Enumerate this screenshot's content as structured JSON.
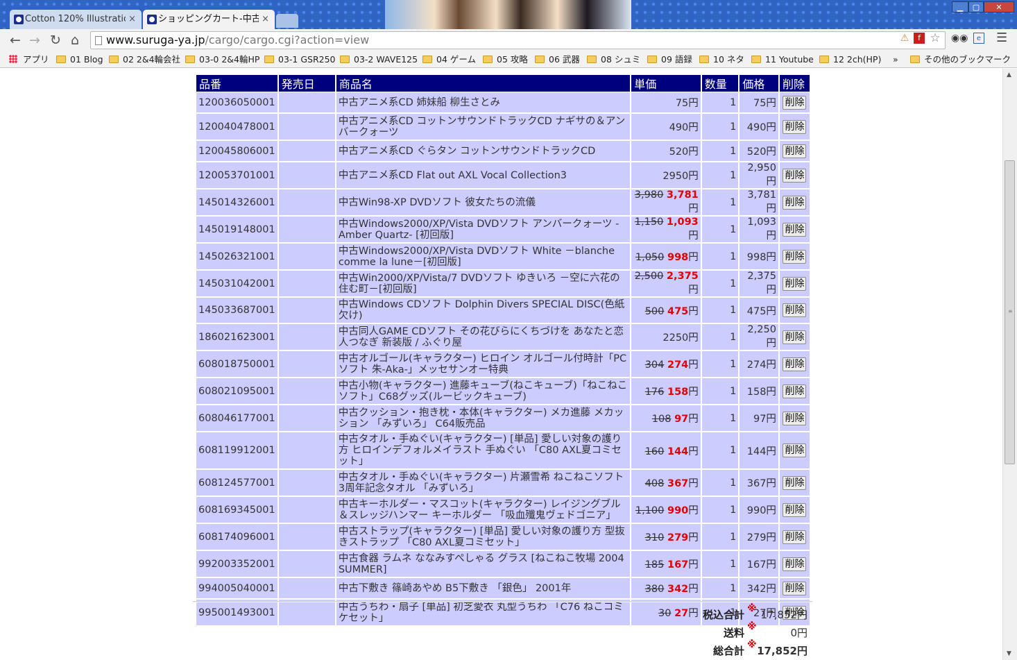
{
  "window": {
    "tabs": [
      {
        "label": "Cotton 120% Illustratio"
      },
      {
        "label": "ショッピングカート-中古"
      }
    ],
    "close_glyph": "×",
    "controls": {
      "minimize": "▁",
      "maximize": "▢",
      "close": "✕"
    }
  },
  "toolbar": {
    "url_host": "www.suruga-ya.jp",
    "url_path": "/cargo/cargo.cgi?action=view"
  },
  "bookmarks": {
    "apps_label": "アプリ",
    "items": [
      {
        "label": "01 Blog"
      },
      {
        "label": "02 2&4輪会社"
      },
      {
        "label": "03-0 2&4輪HP"
      },
      {
        "label": "03-1 GSR250"
      },
      {
        "label": "03-2 WAVE125"
      },
      {
        "label": "04 ゲーム"
      },
      {
        "label": "05 攻略"
      },
      {
        "label": "06 武器"
      },
      {
        "label": "08 シュミ"
      },
      {
        "label": "09 語録"
      },
      {
        "label": "10 ネタ"
      },
      {
        "label": "11 Youtube"
      },
      {
        "label": "12 2ch(HP)"
      }
    ],
    "overflow": "»",
    "other_label": "その他のブックマーク"
  },
  "cart": {
    "headers": {
      "code": "品番",
      "release": "発売日",
      "name": "商品名",
      "unit_price": "単価",
      "qty": "数量",
      "price": "価格",
      "delete": "削除"
    },
    "delete_label": "削除",
    "yen": "円",
    "rows": [
      {
        "code": "120036050001",
        "name": "中古アニメ系CD 姉妹船 柳生さとみ",
        "old_price": "",
        "unit_price": "75",
        "qty": "1",
        "price": "75円"
      },
      {
        "code": "120040478001",
        "name": "中古アニメ系CD コットンサウンドトラックCD ナギサの＆アンバークォーツ",
        "old_price": "",
        "unit_price": "490",
        "qty": "1",
        "price": "490円"
      },
      {
        "code": "120045806001",
        "name": "中古アニメ系CD ぐらタン コットンサウンドトラックCD",
        "old_price": "",
        "unit_price": "520",
        "qty": "1",
        "price": "520円"
      },
      {
        "code": "120053701001",
        "name": "中古アニメ系CD Flat out AXL Vocal Collection3",
        "old_price": "",
        "unit_price": "2950",
        "qty": "1",
        "price": "2,950円"
      },
      {
        "code": "145014326001",
        "name": "中古Win98-XP DVDソフト 彼女たちの流儀",
        "old_price": "3,980",
        "unit_price": "3,781",
        "qty": "1",
        "price": "3,781円"
      },
      {
        "code": "145019148001",
        "name": "中古Windows2000/XP/Vista DVDソフト アンバークォーツ -Amber Quartz- [初回版]",
        "old_price": "1,150",
        "unit_price": "1,093",
        "qty": "1",
        "price": "1,093円"
      },
      {
        "code": "145026321001",
        "name": "中古Windows2000/XP/Vista DVDソフト White －blanche comme la lune－[初回版]",
        "old_price": "1,050",
        "unit_price": "998",
        "qty": "1",
        "price": "998円"
      },
      {
        "code": "145031042001",
        "name": "中古Win2000/XP/Vista/7 DVDソフト ゆきいろ －空に六花の住む町－[初回版]",
        "old_price": "2,500",
        "unit_price": "2,375",
        "qty": "1",
        "price": "2,375円"
      },
      {
        "code": "145033687001",
        "name": "中古Windows CDソフト Dolphin Divers SPECIAL DISC(色紙欠け)",
        "old_price": "500",
        "unit_price": "475",
        "qty": "1",
        "price": "475円"
      },
      {
        "code": "186021623001",
        "name": "中古同人GAME CDソフト その花びらにくちづけを あなたと恋人つなぎ 新装版 / ふぐり屋",
        "old_price": "",
        "unit_price": "2250",
        "qty": "1",
        "price": "2,250円"
      },
      {
        "code": "608018750001",
        "name": "中古オルゴール(キャラクター) ヒロイン オルゴール付時計「PCソフト 朱-Aka-」メッセサンオー特典",
        "old_price": "304",
        "unit_price": "274",
        "qty": "1",
        "price": "274円"
      },
      {
        "code": "608021095001",
        "name": "中古小物(キャラクター) 進藤キューブ(ねこキューブ)「ねこねこソフト」C68グッズ(ルービックキューブ)",
        "old_price": "176",
        "unit_price": "158",
        "qty": "1",
        "price": "158円"
      },
      {
        "code": "608046177001",
        "name": "中古クッション・抱き枕・本体(キャラクター) メカ進藤 メカッション 「みずいろ」 C64販売品",
        "old_price": "108",
        "unit_price": "97",
        "qty": "1",
        "price": "97円"
      },
      {
        "code": "608119912001",
        "name": "中古タオル・手ぬぐい(キャラクター) [単品] 愛しい対象の護り方 ヒロインデフォルメイラスト 手ぬぐい 「C80 AXL夏コミセット」",
        "old_price": "160",
        "unit_price": "144",
        "qty": "1",
        "price": "144円"
      },
      {
        "code": "608124577001",
        "name": "中古タオル・手ぬぐい(キャラクター) 片瀬雪希 ねこねこソフト3周年記念タオル 「みずいろ」",
        "old_price": "408",
        "unit_price": "367",
        "qty": "1",
        "price": "367円"
      },
      {
        "code": "608169345001",
        "name": "中古キーホルダー・マスコット(キャラクター) レイジングブル＆スレッジハンマー キーホルダー 「吸血殲鬼ヴェドゴニア」",
        "old_price": "1,100",
        "unit_price": "990",
        "qty": "1",
        "price": "990円"
      },
      {
        "code": "608174096001",
        "name": "中古ストラップ(キャラクター) [単品] 愛しい対象の護り方 型抜きストラップ 「C80 AXL夏コミセット」",
        "old_price": "310",
        "unit_price": "279",
        "qty": "1",
        "price": "279円"
      },
      {
        "code": "992003352001",
        "name": "中古食器 ラムネ ななみすぺしゃる グラス [ねこねこ牧場 2004 SUMMER]",
        "old_price": "185",
        "unit_price": "167",
        "qty": "1",
        "price": "167円"
      },
      {
        "code": "994005040001",
        "name": "中古下敷き 篠崎あやめ B5下敷き 「銀色」 2001年",
        "old_price": "380",
        "unit_price": "342",
        "qty": "1",
        "price": "342円"
      },
      {
        "code": "995001493001",
        "name": "中古うちわ・扇子 [単品] 初芝愛衣 丸型うちわ 「C76 ねこコミケセット」",
        "old_price": "30",
        "unit_price": "27",
        "qty": "1",
        "price": "27円"
      }
    ]
  },
  "summary": {
    "note_mark": "※",
    "subtotal_label": "税込合計",
    "subtotal_value": "17,852円",
    "shipping_label": "送料",
    "shipping_value": "0円",
    "total_label": "総合計",
    "total_value": "17,852円"
  }
}
